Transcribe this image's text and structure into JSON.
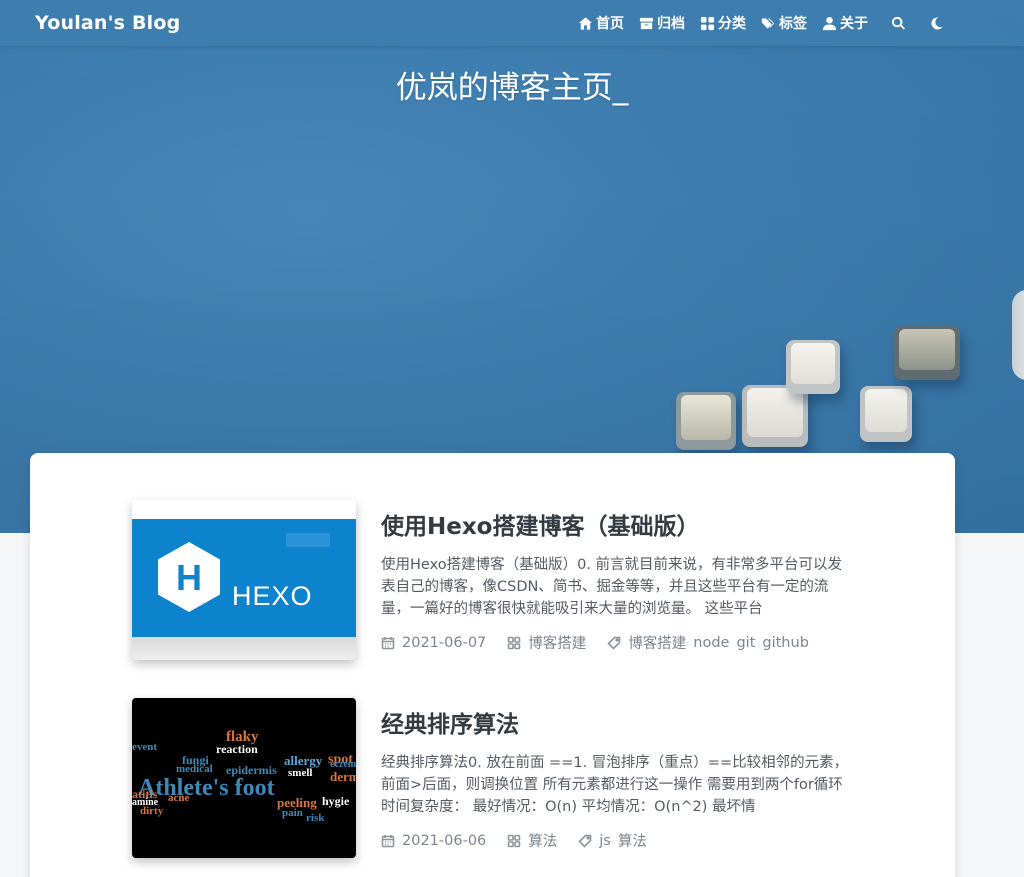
{
  "brand": "Youlan's Blog",
  "nav": {
    "items": [
      {
        "label": "首页",
        "icon": "home-icon"
      },
      {
        "label": "归档",
        "icon": "archive-icon"
      },
      {
        "label": "分类",
        "icon": "category-icon"
      },
      {
        "label": "标签",
        "icon": "tags-icon"
      },
      {
        "label": "关于",
        "icon": "user-icon"
      }
    ],
    "search_icon": "search-icon",
    "darkmode_icon": "moon-icon"
  },
  "hero": {
    "subtitle": "优岚的博客主页_"
  },
  "posts": [
    {
      "title": "使用Hexo搭建博客（基础版）",
      "excerpt": "使用Hexo搭建博客（基础版）0. 前言就目前来说，有非常多平台可以发表自己的博客，像CSDN、简书、掘金等等，并且这些平台有一定的流量，一篇好的博客很快就能吸引来大量的浏览量。 这些平台",
      "date": "2021-06-07",
      "category": "博客搭建",
      "tags": [
        "博客搭建",
        "node",
        "git",
        "github"
      ],
      "thumb_text": "HEXO",
      "thumb_letter": "H"
    },
    {
      "title": "经典排序算法",
      "excerpt": "经典排序算法0. 放在前面 ==1. 冒泡排序（重点）==比较相邻的元素，前面>后面，则调换位置 所有元素都进行这一操作 需要用到两个for循环 时间复杂度： 最好情况：O(n) 平均情况：O(n^2) 最坏情",
      "date": "2021-06-06",
      "category": "算法",
      "tags": [
        "js",
        "算法"
      ],
      "thumb_words": {
        "w1": "Athlete's foot",
        "w2": "flaky",
        "w3": "reaction",
        "w4": "fungi",
        "w5": "epidermis",
        "w6": "allergy",
        "w7": "spot",
        "w8": "medical",
        "w9": "smell",
        "w10": "acne",
        "w11": "peeling",
        "w12": "dirty",
        "w13": "pain",
        "w14": "risk",
        "w15": "hygie",
        "w16": "event",
        "w17": "derm",
        "w18": "atitis",
        "w19": "amine",
        "w20": "eczem"
      }
    }
  ],
  "colors": {
    "navbar": "#3e7eaf",
    "hero": "#3f80b3",
    "hexo_blue": "#0e83cd",
    "title": "#333a40",
    "meta": "#7c858e"
  }
}
